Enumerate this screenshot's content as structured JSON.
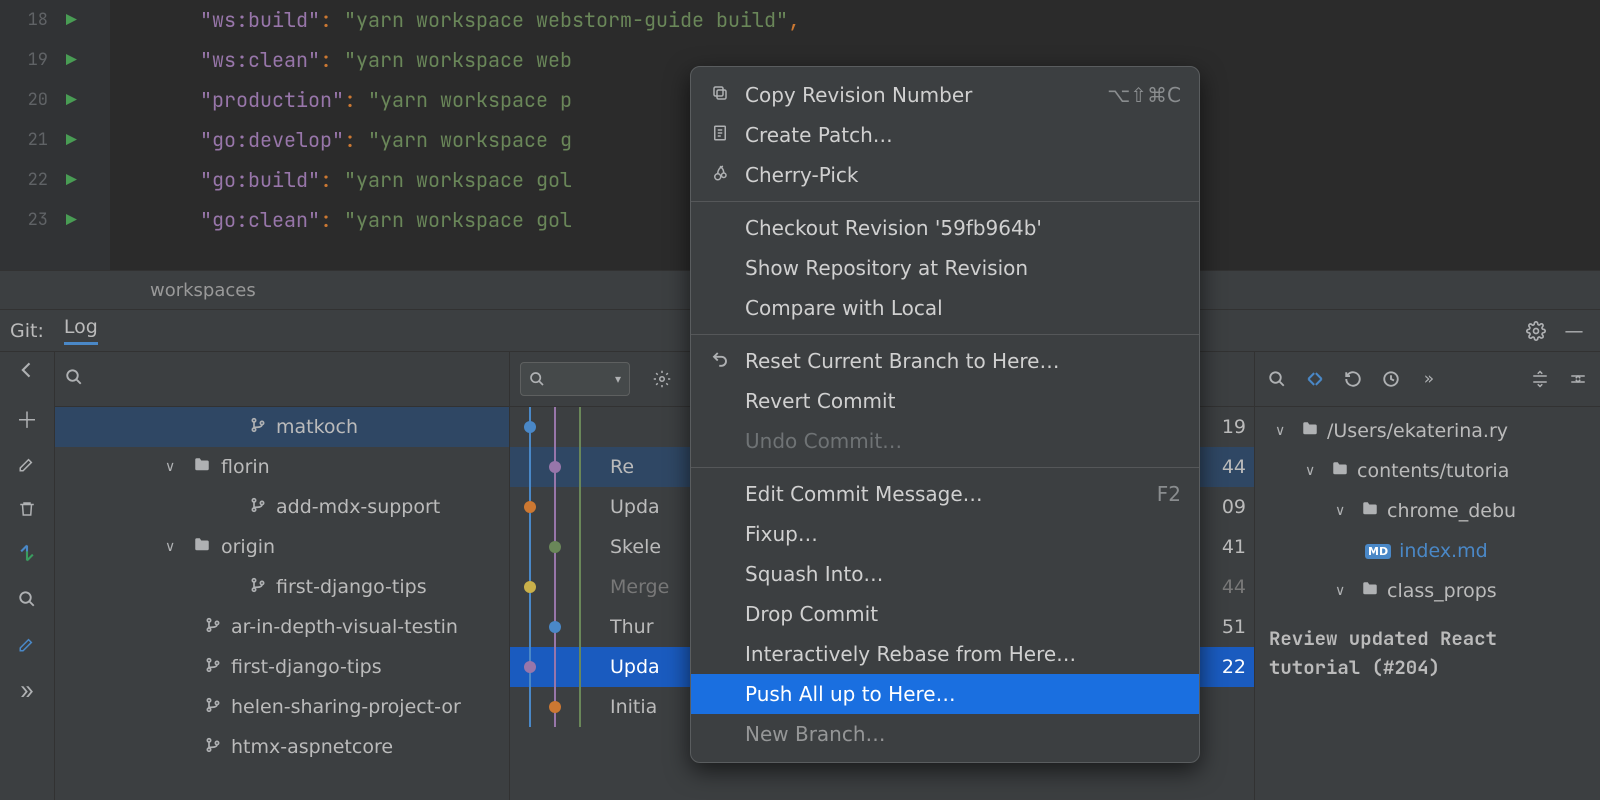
{
  "editor": {
    "lines": [
      {
        "num": "18",
        "key": "\"ws:build\"",
        "val": "\"yarn workspace webstorm-guide build\"",
        "trailing_comma": true
      },
      {
        "num": "19",
        "key": "\"ws:clean\"",
        "val": "\"yarn workspace web"
      },
      {
        "num": "20",
        "key": "\"production\"",
        "val": "\"yarn workspace p"
      },
      {
        "num": "21",
        "key": "\"go:develop\"",
        "val": "\"yarn workspace g"
      },
      {
        "num": "22",
        "key": "\"go:build\"",
        "val": "\"yarn workspace gol"
      },
      {
        "num": "23",
        "key": "\"go:clean\"",
        "val": "\"yarn workspace gol"
      }
    ],
    "breadcrumb": "workspaces"
  },
  "git_header": {
    "label": "Git:",
    "tab": "Log"
  },
  "branches": {
    "selected": "matkoch",
    "groups": [
      {
        "type": "branch",
        "indent": 3,
        "name": "matkoch",
        "selected": true
      },
      {
        "type": "folder",
        "indent": 1,
        "expanded": true,
        "name": "florin"
      },
      {
        "type": "branch",
        "indent": 3,
        "name": "add-mdx-support"
      },
      {
        "type": "folder",
        "indent": 1,
        "expanded": true,
        "name": "origin"
      },
      {
        "type": "branch",
        "indent": 3,
        "name": "first-django-tips"
      },
      {
        "type": "branch",
        "indent": 2,
        "name": "ar-in-depth-visual-testin"
      },
      {
        "type": "branch",
        "indent": 2,
        "name": "first-django-tips"
      },
      {
        "type": "branch",
        "indent": 2,
        "name": "helen-sharing-project-or"
      },
      {
        "type": "branch",
        "indent": 2,
        "name": "htmx-aspnetcore"
      }
    ]
  },
  "commits": [
    {
      "text": "",
      "count": "19",
      "selected": false,
      "highlighted": false
    },
    {
      "text": "Re",
      "count": "44",
      "selected": false,
      "highlighted": true
    },
    {
      "text": "Upda",
      "count": "09",
      "selected": false
    },
    {
      "text": "Skele",
      "count": "41",
      "selected": false
    },
    {
      "text": "Merge",
      "count": "44",
      "dim": true
    },
    {
      "text": "Thur",
      "count": "51",
      "selected": false
    },
    {
      "text": "Upda",
      "count": "22",
      "selected": true
    },
    {
      "text": "Initia",
      "count": "",
      "selected": false
    }
  ],
  "details": {
    "tree": [
      {
        "indent": 1,
        "expanded": true,
        "icon": "folder",
        "name": "/Users/ekaterina.ry"
      },
      {
        "indent": 2,
        "expanded": true,
        "icon": "folder",
        "name": "contents/tutoria"
      },
      {
        "indent": 3,
        "expanded": true,
        "icon": "folder",
        "name": "chrome_debu"
      },
      {
        "indent": 4,
        "expanded": false,
        "icon": "file-md",
        "name": "index.md"
      },
      {
        "indent": 3,
        "expanded": true,
        "icon": "folder",
        "name": "class_props"
      }
    ],
    "message": "Review updated React tutorial (#204)"
  },
  "context_menu": {
    "items": [
      {
        "icon": "copy",
        "label": "Copy Revision Number",
        "shortcut": "⌥⇧⌘C"
      },
      {
        "icon": "patch",
        "label": "Create Patch…"
      },
      {
        "icon": "cherry",
        "label": "Cherry-Pick"
      },
      {
        "sep": true
      },
      {
        "icon": "",
        "label": "Checkout Revision '59fb964b'"
      },
      {
        "icon": "",
        "label": "Show Repository at Revision"
      },
      {
        "icon": "",
        "label": "Compare with Local"
      },
      {
        "sep": true
      },
      {
        "icon": "undo",
        "label": "Reset Current Branch to Here…"
      },
      {
        "icon": "",
        "label": "Revert Commit"
      },
      {
        "icon": "",
        "label": "Undo Commit…",
        "disabled": true
      },
      {
        "sep": true
      },
      {
        "icon": "",
        "label": "Edit Commit Message…",
        "shortcut": "F2"
      },
      {
        "icon": "",
        "label": "Fixup…"
      },
      {
        "icon": "",
        "label": "Squash Into…"
      },
      {
        "icon": "",
        "label": "Drop Commit"
      },
      {
        "icon": "",
        "label": "Interactively Rebase from Here…"
      },
      {
        "icon": "",
        "label": "Push All up to Here…",
        "selected": true
      },
      {
        "icon": "",
        "label": "New Branch…",
        "cut": true
      }
    ]
  }
}
